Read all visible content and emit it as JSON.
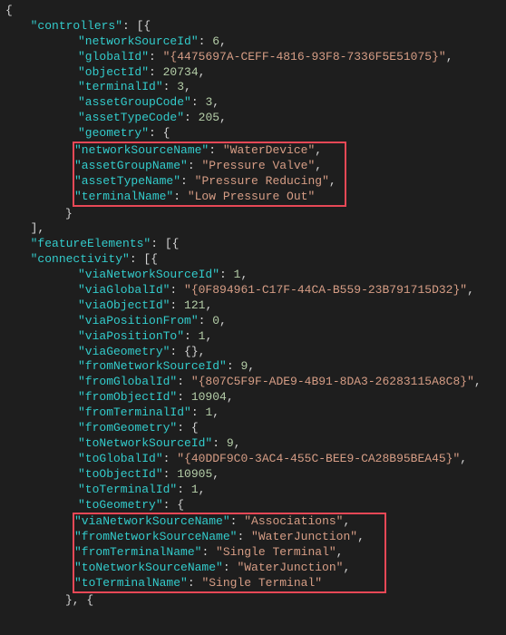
{
  "root": {
    "open": "{",
    "controllers_key": "\"controllers\"",
    "controllers_open": ": [{",
    "controllers": {
      "networkSourceId_k": "\"networkSourceId\"",
      "networkSourceId_v": "6",
      "globalId_k": "\"globalId\"",
      "globalId_v": "\"{4475697A-CEFF-4816-93F8-7336F5E51075}\"",
      "objectId_k": "\"objectId\"",
      "objectId_v": "20734",
      "terminalId_k": "\"terminalId\"",
      "terminalId_v": "3",
      "assetGroupCode_k": "\"assetGroupCode\"",
      "assetGroupCode_v": "3",
      "assetTypeCode_k": "\"assetTypeCode\"",
      "assetTypeCode_v": "205",
      "geometry_k": "\"geometry\"",
      "geometry_v": ": {"
    },
    "hl1": {
      "networkSourceName_k": "\"networkSourceName\"",
      "networkSourceName_v": "\"WaterDevice\"",
      "assetGroupName_k": "\"assetGroupName\"",
      "assetGroupName_v": "\"Pressure Valve\"",
      "assetTypeName_k": "\"assetTypeName\"",
      "assetTypeName_v": "\"Pressure Reducing\"",
      "terminalName_k": "\"terminalName\"",
      "terminalName_v": "\"Low Pressure Out\""
    },
    "close_brace": "}",
    "close_array": "],",
    "featureElements_k": "\"featureElements\"",
    "featureElements_v": ": [{",
    "connectivity_k": "\"connectivity\"",
    "connectivity_v": ": [{",
    "conn": {
      "viaNetworkSourceId_k": "\"viaNetworkSourceId\"",
      "viaNetworkSourceId_v": "1",
      "viaGlobalId_k": "\"viaGlobalId\"",
      "viaGlobalId_v": "\"{0F894961-C17F-44CA-B559-23B791715D32}\"",
      "viaObjectId_k": "\"viaObjectId\"",
      "viaObjectId_v": "121",
      "viaPositionFrom_k": "\"viaPositionFrom\"",
      "viaPositionFrom_v": "0",
      "viaPositionTo_k": "\"viaPositionTo\"",
      "viaPositionTo_v": "1",
      "viaGeometry_k": "\"viaGeometry\"",
      "viaGeometry_v": ": {},",
      "fromNetworkSourceId_k": "\"fromNetworkSourceId\"",
      "fromNetworkSourceId_v": "9",
      "fromGlobalId_k": "\"fromGlobalId\"",
      "fromGlobalId_v": "\"{807C5F9F-ADE9-4B91-8DA3-26283115A8C8}\"",
      "fromObjectId_k": "\"fromObjectId\"",
      "fromObjectId_v": "10904",
      "fromTerminalId_k": "\"fromTerminalId\"",
      "fromTerminalId_v": "1",
      "fromGeometry_k": "\"fromGeometry\"",
      "fromGeometry_v": ": {",
      "toNetworkSourceId_k": "\"toNetworkSourceId\"",
      "toNetworkSourceId_v": "9",
      "toGlobalId_k": "\"toGlobalId\"",
      "toGlobalId_v": "\"{40DDF9C0-3AC4-455C-BEE9-CA28B95BEA45}\"",
      "toObjectId_k": "\"toObjectId\"",
      "toObjectId_v": "10905",
      "toTerminalId_k": "\"toTerminalId\"",
      "toTerminalId_v": "1",
      "toGeometry_k": "\"toGeometry\"",
      "toGeometry_v": ": {"
    },
    "hl2": {
      "viaNetworkSourceName_k": "\"viaNetworkSourceName\"",
      "viaNetworkSourceName_v": "\"Associations\"",
      "fromNetworkSourceName_k": "\"fromNetworkSourceName\"",
      "fromNetworkSourceName_v": "\"WaterJunction\"",
      "fromTerminalName_k": "\"fromTerminalName\"",
      "fromTerminalName_v": "\"Single Terminal\"",
      "toNetworkSourceName_k": "\"toNetworkSourceName\"",
      "toNetworkSourceName_v": "\"WaterJunction\"",
      "toTerminalName_k": "\"toTerminalName\"",
      "toTerminalName_v": "\"Single Terminal\""
    },
    "close_obj_comma": "}, {"
  }
}
